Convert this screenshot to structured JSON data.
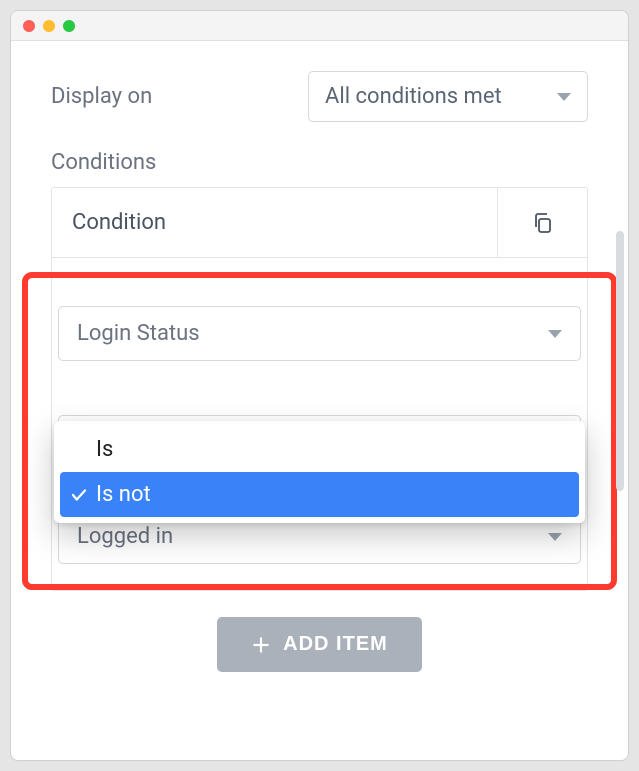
{
  "header": {
    "display_on_label": "Display on",
    "display_on_value": "All conditions met"
  },
  "conditions": {
    "section_label": "Conditions",
    "column_header": "Condition",
    "fields": {
      "field1_value": "Login Status",
      "operator_options": {
        "is": "Is",
        "is_not": "Is not"
      },
      "operator_selected": "is_not",
      "field3_value": "Logged in"
    }
  },
  "actions": {
    "add_item_label": "ADD ITEM"
  }
}
